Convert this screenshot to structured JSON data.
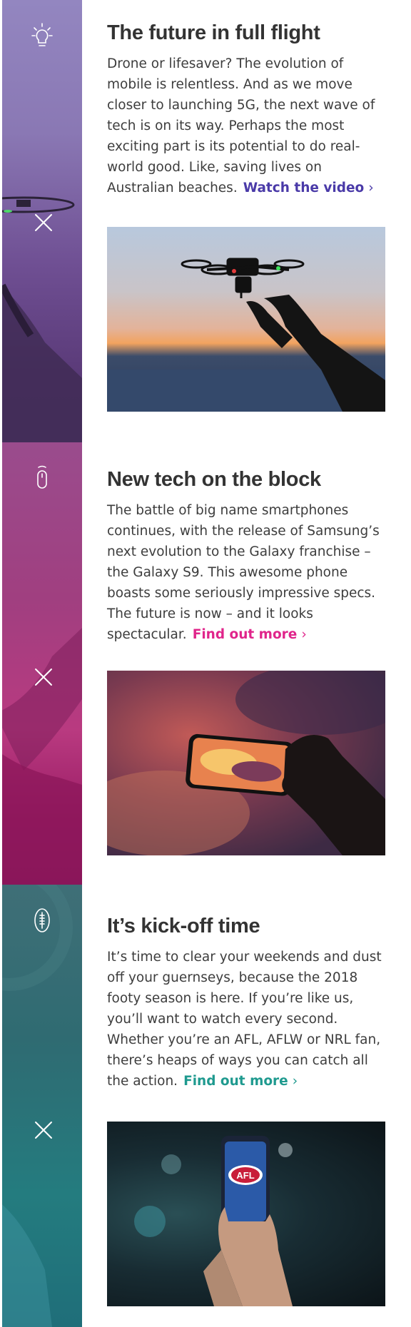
{
  "sections": [
    {
      "title": "The future in full flight",
      "body": "Drone or lifesaver? The evolution of mobile is relentless. And as we move closer to launching 5G, the next wave of tech is on its way. Perhaps the most exciting part is its potential to do real-world good. Like, saving lives on Australian beaches.",
      "cta_label": "Watch the video",
      "icon": "lightbulb-icon",
      "accent": "#4a3aa8"
    },
    {
      "title": "New tech on the block",
      "body": "The battle of big name smartphones continues, with the release of Samsung’s next evolution to the Galaxy franchise – the Galaxy S9. This awesome phone boasts some seriously impressive specs. The future is now – and it looks spectacular.",
      "cta_label": "Find out more",
      "icon": "mouse-icon",
      "accent": "#e0258b"
    },
    {
      "title": "It’s kick-off time",
      "body": "It’s time to clear your weekends and dust off your guernseys, because the 2018 footy season is here. If you’re like us, you’ll want to watch every second. Whether you’re an AFL, AFLW or NRL fan, there’s heaps of ways you can catch all the action.",
      "cta_label": "Find out more",
      "icon": "football-icon",
      "accent": "#1f9a8f"
    }
  ],
  "chevron": "›",
  "afl_logo_text": "AFL"
}
